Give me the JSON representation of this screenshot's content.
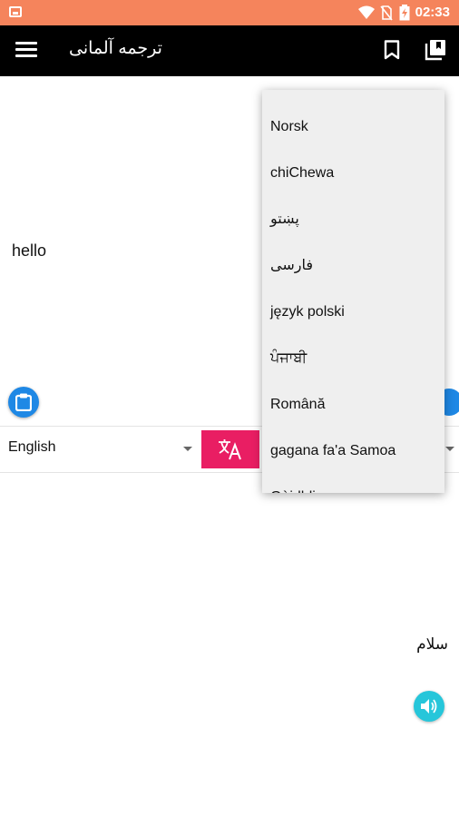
{
  "status_bar": {
    "time": "02:33",
    "icons": [
      "image-icon",
      "wifi-icon",
      "no-sim-icon",
      "battery-charging-icon"
    ]
  },
  "toolbar": {
    "title": "ترجمه آلمانی",
    "icons": [
      "menu-icon",
      "bookmark-icon",
      "library-icon"
    ]
  },
  "source": {
    "text": "hello",
    "language": "English",
    "paste_icon": "clipboard-icon"
  },
  "translate_icon": "translate-icon",
  "target": {
    "text": "سلام",
    "speak_icon": "volume-icon"
  },
  "language_dropdown": {
    "items": [
      "Norsk",
      "chiChewa",
      "پښتو",
      "فارسی",
      "język polski",
      "ਪੰਜਾਬੀ",
      "Română",
      "gagana fa'a Samoa",
      "Gàidhlig"
    ]
  },
  "colors": {
    "status_bar": "#f5845c",
    "toolbar": "#000000",
    "translate_button": "#e91e63",
    "paste_button": "#1e88e5",
    "speak_button": "#26c6da",
    "dropdown_bg": "#efefef"
  }
}
